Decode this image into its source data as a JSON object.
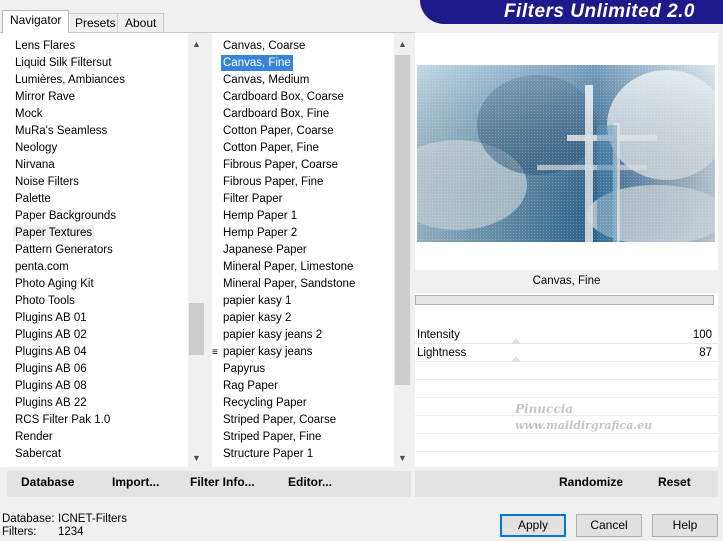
{
  "tabs": [
    {
      "label": "Navigator"
    },
    {
      "label": "Presets"
    },
    {
      "label": "About"
    }
  ],
  "banner": {
    "title": "Filters Unlimited 2.0"
  },
  "categories": {
    "selected": "Paper Textures",
    "items": [
      "Lens Flares",
      "Liquid Silk Filtersut",
      "Lumières, Ambiances",
      "Mirror Rave",
      "Mock",
      "MuRa's Seamless",
      "Neology",
      "Nirvana",
      "Noise Filters",
      "Palette",
      "Paper Backgrounds",
      "Paper Textures",
      "Pattern Generators",
      "penta.com",
      "Photo Aging Kit",
      "Photo Tools",
      "Plugins AB 01",
      "Plugins AB 02",
      "Plugins AB 04",
      "Plugins AB 06",
      "Plugins AB 08",
      "Plugins AB 22",
      "RCS Filter Pak 1.0",
      "Render",
      "Sabercat"
    ]
  },
  "filters": {
    "selected": "Canvas, Fine",
    "items": [
      "Canvas, Coarse",
      "Canvas, Fine",
      "Canvas, Medium",
      "Cardboard Box, Coarse",
      "Cardboard Box, Fine",
      "Cotton Paper, Coarse",
      "Cotton Paper, Fine",
      "Fibrous Paper, Coarse",
      "Fibrous Paper, Fine",
      "Filter Paper",
      "Hemp Paper 1",
      "Hemp Paper 2",
      "Japanese Paper",
      "Mineral Paper, Limestone",
      "Mineral Paper, Sandstone",
      "papier kasy 1",
      "papier kasy 2",
      "papier kasy jeans 2",
      "papier kasy jeans",
      "Papyrus",
      "Rag Paper",
      "Recycling Paper",
      "Striped Paper, Coarse",
      "Striped Paper, Fine",
      "Structure Paper 1"
    ]
  },
  "preview": {
    "filter_name": "Canvas, Fine",
    "params": [
      {
        "name": "Intensity",
        "value": 100
      },
      {
        "name": "Lightness",
        "value": 87
      }
    ],
    "watermark": {
      "line1": "Pinuccia",
      "line2": "www.maildirgrafica.eu"
    }
  },
  "left_buttons": {
    "database": "Database",
    "import": "Import...",
    "filter_info": "Filter Info...",
    "editor": "Editor..."
  },
  "right_buttons": {
    "randomize": "Randomize",
    "reset": "Reset"
  },
  "status": {
    "database_label": "Database:",
    "database_value": "ICNET-Filters",
    "filters_label": "Filters:",
    "filters_value": "1234"
  },
  "dialog_buttons": {
    "apply": "Apply",
    "cancel": "Cancel",
    "help": "Help"
  },
  "colors": {
    "banner": "#1e1a8c",
    "selection": "#3a84d8"
  }
}
